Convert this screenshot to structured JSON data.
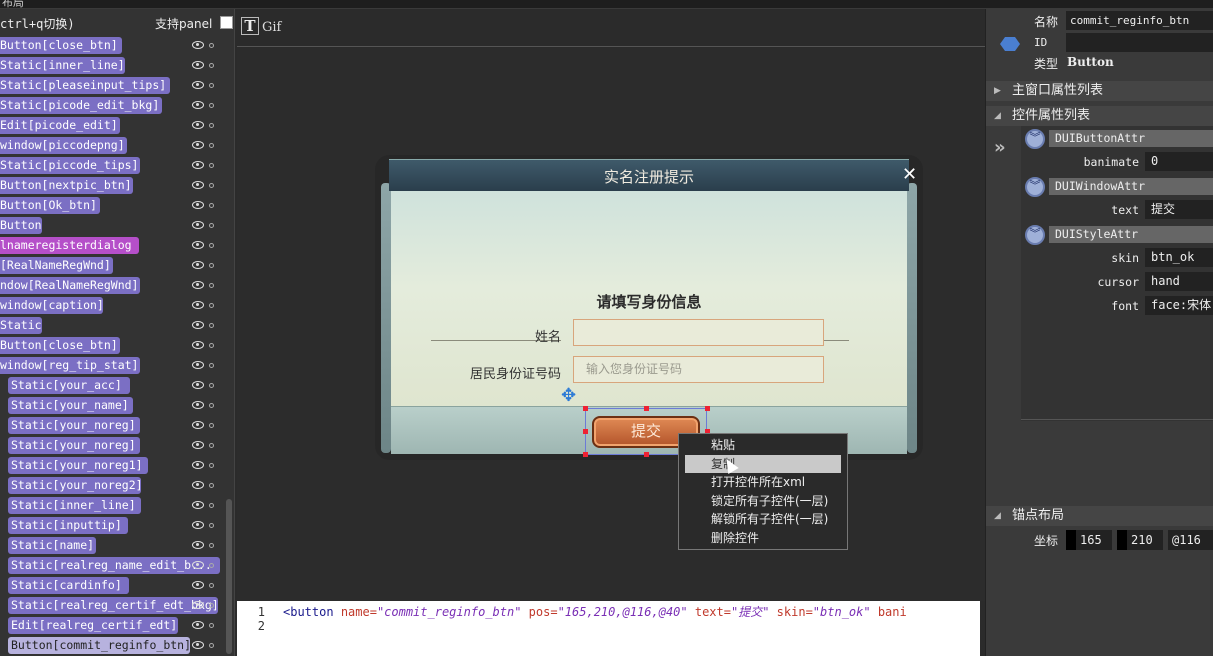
{
  "window": {
    "title": "布局"
  },
  "tree": {
    "hint": "ctrl+q切换)",
    "support_panel_label": "支持panel",
    "items": [
      {
        "label": "Button[close_btn]"
      },
      {
        "label": "Static[inner_line]"
      },
      {
        "label": "Static[pleaseinput_tips]"
      },
      {
        "label": "Static[picode_edit_bkg]"
      },
      {
        "label": "Edit[picode_edit]"
      },
      {
        "label": "window[piccodepng]"
      },
      {
        "label": "Static[piccode_tips]"
      },
      {
        "label": "Button[nextpic_btn]"
      },
      {
        "label": "Button[Ok_btn]"
      },
      {
        "label": "Button"
      },
      {
        "label": "lnameregisterdialog"
      },
      {
        "label": "[RealNameRegWnd]"
      },
      {
        "label": "ndow[RealNameRegWnd]"
      },
      {
        "label": "window[caption]"
      },
      {
        "label": "Static"
      },
      {
        "label": "Button[close_btn]"
      },
      {
        "label": "window[reg_tip_stat]"
      },
      {
        "label": "Static[your_acc]"
      },
      {
        "label": "Static[your_name]"
      },
      {
        "label": "Static[your_noreg]"
      },
      {
        "label": "Static[your_noreg]"
      },
      {
        "label": "Static[your_noreg1]"
      },
      {
        "label": "Static[your_noreg2]"
      },
      {
        "label": "Static[inner_line]"
      },
      {
        "label": "Static[inputtip]"
      },
      {
        "label": "Static[name]"
      },
      {
        "label": "Static[realreg_name_edit_b..."
      },
      {
        "label": "Static[cardinfo]"
      },
      {
        "label": "Static[realreg_certif_edt_bkg]"
      },
      {
        "label": "Edit[realreg_certif_edt]"
      },
      {
        "label": "Button[commit_reginfo_btn]"
      }
    ]
  },
  "toolbar": {
    "text_tool_icon": "T",
    "gif_label": "Gif"
  },
  "dialog": {
    "title": "实名注册提示",
    "close_glyph": "✕",
    "heading": "请填写身份信息",
    "name_label": "姓名",
    "name_value": "",
    "id_label": "居民身份证号码",
    "id_placeholder": "输入您身份证号码",
    "submit_label": "提交"
  },
  "context_menu": {
    "items": [
      {
        "label": "粘贴"
      },
      {
        "label": "复制"
      },
      {
        "label": "打开控件所在xml"
      },
      {
        "label": "锁定所有子控件(一层)"
      },
      {
        "label": "解锁所有子控件(一层)"
      },
      {
        "label": "删除控件"
      }
    ]
  },
  "code": {
    "line1_no": "1",
    "line2_no": "2",
    "tag_open": "<button",
    "attr_name": "name=",
    "val_name": "\"commit_reginfo_btn\"",
    "attr_pos": "pos=",
    "val_pos": "\"165,210,@116,@40\"",
    "attr_text": "text=",
    "val_text": "\"提交\"",
    "attr_skin": "skin=",
    "val_skin": "\"btn_ok\"",
    "attr_bani": "bani"
  },
  "properties": {
    "name_label": "名称",
    "name_value": "commit_reginfo_btn",
    "id_label": "ID",
    "id_value": "",
    "type_label": "类型",
    "type_value": "Button",
    "main_window_section": "主窗口属性列表",
    "control_section": "控件属性列表",
    "groups": [
      {
        "name": "DUIButtonAttr"
      },
      {
        "name": "DUIWindowAttr"
      },
      {
        "name": "DUIStyleAttr"
      }
    ],
    "attrs": {
      "banimate_key": "banimate",
      "banimate_val": "0",
      "text_key": "text",
      "text_val": "提交",
      "skin_key": "skin",
      "skin_val": "btn_ok",
      "cursor_key": "cursor",
      "cursor_val": "hand",
      "font_key": "font",
      "font_val": "face:宋体"
    },
    "anchor_section": "锚点布局",
    "coord_label": "坐标",
    "coord_x": "165",
    "coord_y": "210",
    "coord_w": "@116"
  }
}
